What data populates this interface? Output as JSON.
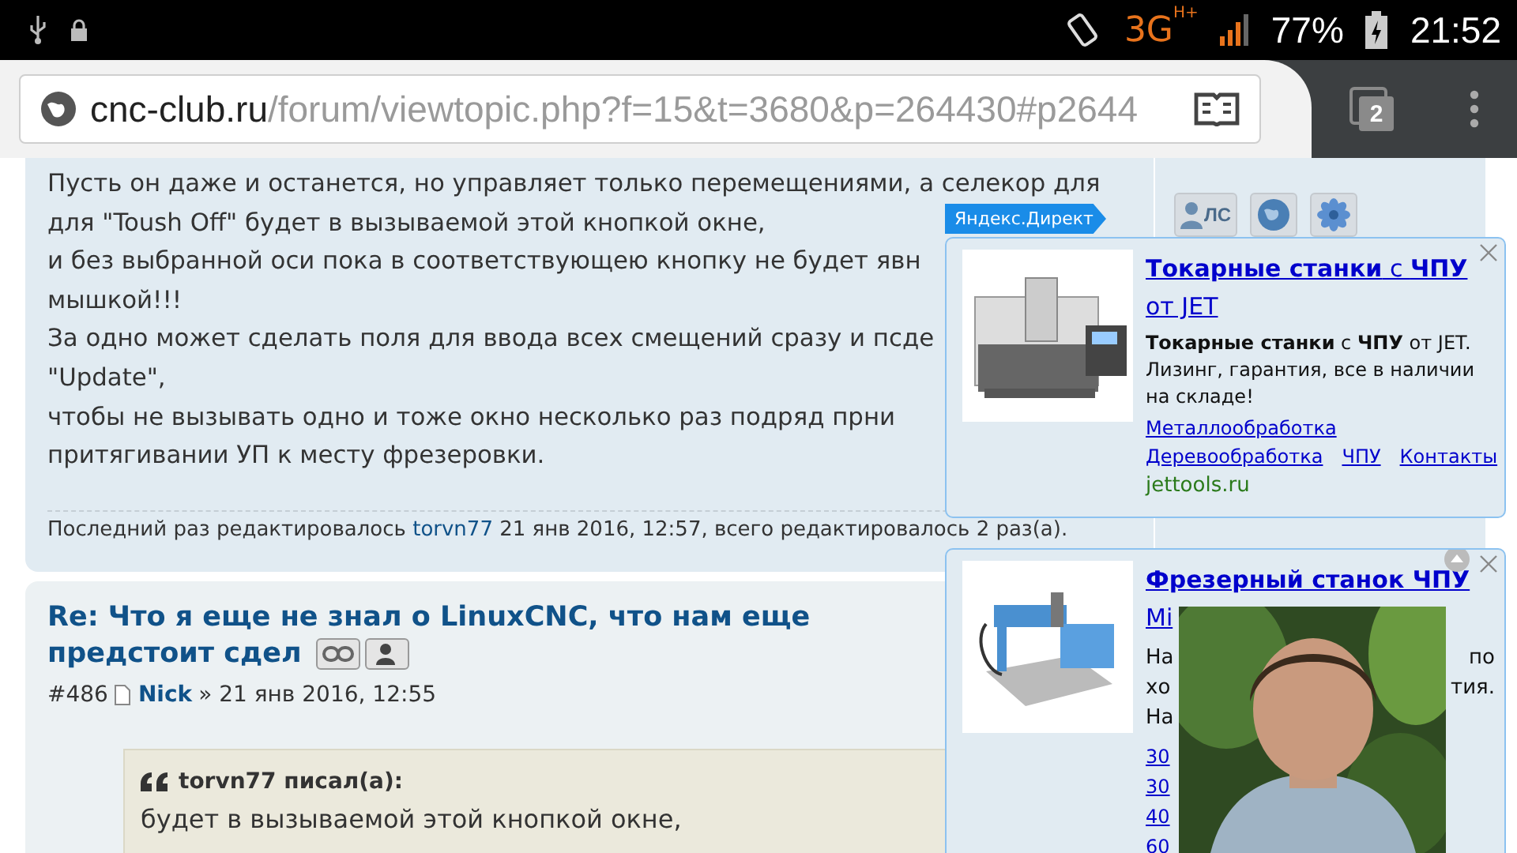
{
  "status_bar": {
    "network": "3G",
    "network_sub": "H+",
    "battery": "77%",
    "time": "21:52"
  },
  "browser": {
    "domain": "cnc-club.ru",
    "path": "/forum/viewtopic.php?f=15&t=3680&p=264430#p2644",
    "tab_count": "2"
  },
  "post_1": {
    "lines": [
      "Пусть он даже и останется, но управляет только перемещениями, а селекор для",
      "для \"Toush Off\" будет в вызываемой этой кнопкой окне,",
      "и без выбранной оси пока в соответствующею кнопку не будет явн",
      "мышкой!!!",
      "За одно может сделать поля для ввода всех смещений сразу и псде",
      "\"Update\",",
      "чтобы не вызывать одно и тоже окно несколько раз подряд прни",
      "притягивании УП к месту фрезеровки."
    ],
    "edit_note": {
      "before": "Последний раз редактировалось",
      "user": "torvn77",
      "after": "21 янв 2016, 12:57, всего редактировалось 2 раз(а)."
    },
    "profile_buttons": [
      {
        "kind": "pm",
        "label": "ЛС"
      },
      {
        "kind": "globe"
      },
      {
        "kind": "flower"
      }
    ]
  },
  "post_2": {
    "title": "Re: Что я еще не знал о LinuxCNC, что нам еще предстоит сдел",
    "number": "#486",
    "author": "Nick",
    "date": "» 21 янв 2016, 12:55",
    "quote": {
      "author": "torvn77 писал(а):",
      "text": "будет в вызываемой этой кнопкой окне,"
    }
  },
  "ad_label": "Яндекс.Директ",
  "ads": [
    {
      "title": "**Токарные станки** с **ЧПУ** от JET",
      "description": "**Токарные станки** с **ЧПУ** от JET. Лизинг, гарантия, все в наличии на складе!",
      "links": [
        [
          "Металлообработка"
        ],
        [
          "Деревообработка",
          "ЧПУ",
          "Контакты"
        ]
      ],
      "domain": "jettools.ru",
      "covered": false,
      "scroll_up": false
    },
    {
      "title": "**Фрезерный станок ЧПУ**",
      "title_2": "Mi",
      "description_fragments": [
        {
          "left": "На",
          "right": "по"
        },
        {
          "left": "хо",
          "right": "тия."
        },
        {
          "left": "На"
        }
      ],
      "link_fragments": [
        "30",
        "30",
        "40",
        "60"
      ],
      "covered": true,
      "scroll_up": true
    }
  ]
}
